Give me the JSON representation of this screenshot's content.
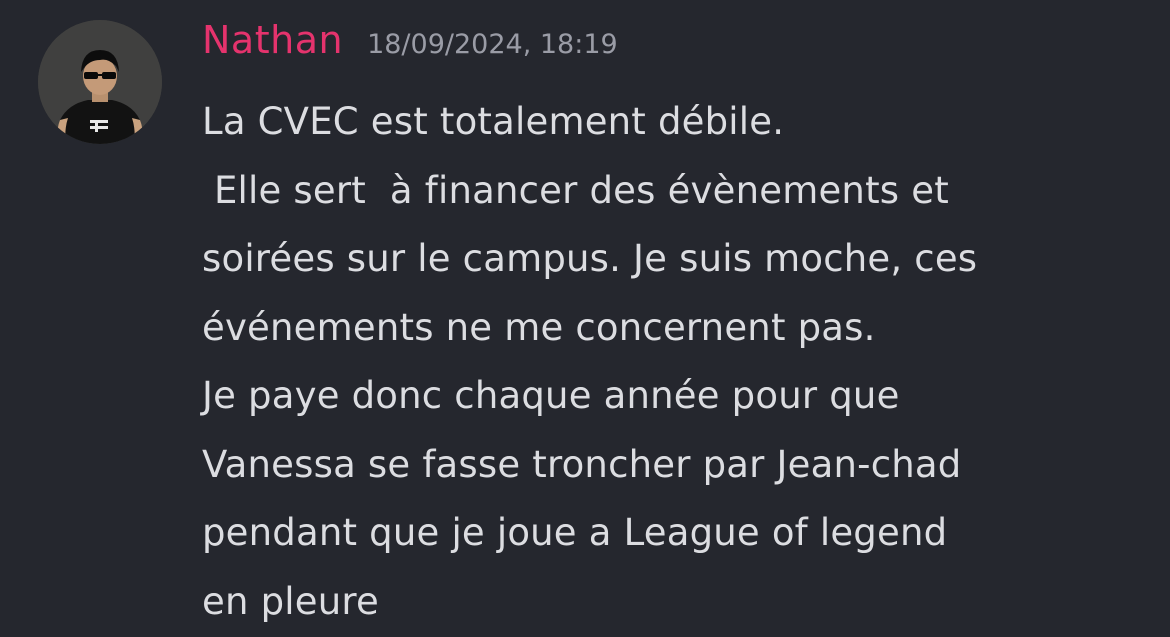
{
  "message": {
    "author": "Nathan",
    "timestamp": "18/09/2024, 18:19",
    "author_color": "#e5336d",
    "avatar_icon": "user-avatar",
    "lines": [
      "La CVEC est totalement débile.",
      " Elle sert  à financer des évènements et",
      "soirées sur le campus. Je suis moche, ces",
      "événements ne me concernent pas.",
      "Je paye donc chaque année pour que",
      "Vanessa se fasse troncher par Jean-chad",
      "pendant que je joue a League of legend",
      "en pleure"
    ]
  },
  "colors": {
    "background": "#25272e",
    "text": "#dcdde1",
    "timestamp": "#9a9ca6"
  }
}
